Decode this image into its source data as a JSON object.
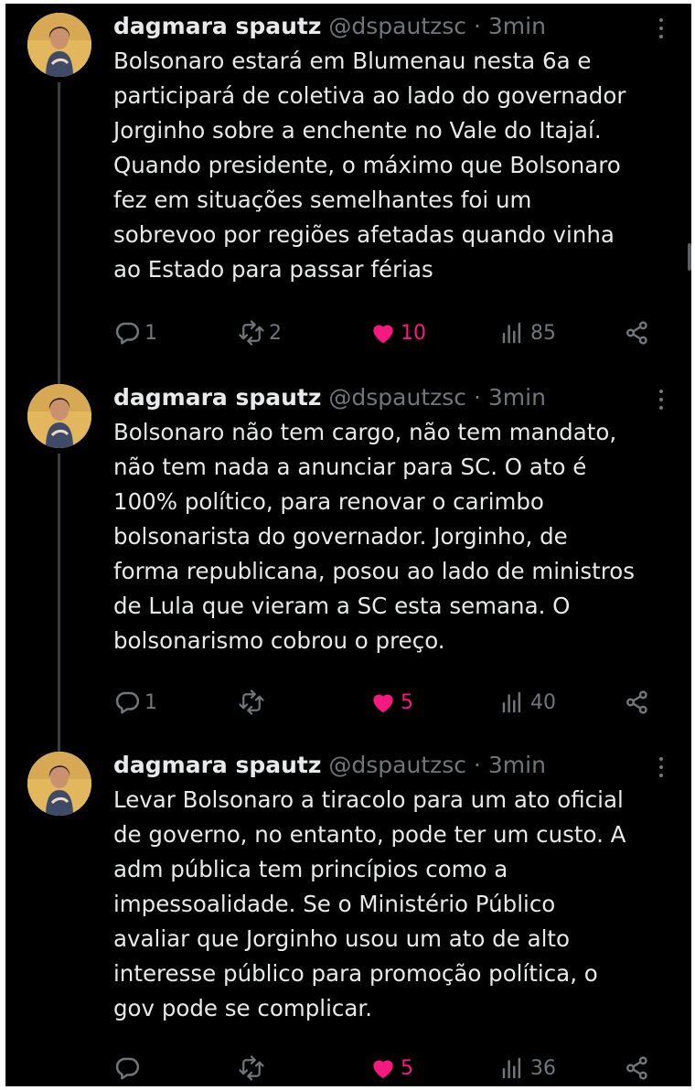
{
  "tweets": [
    {
      "name": "dagmara spautz",
      "handle": "@dspautzsc",
      "separator": "·",
      "time": "3min",
      "lines": [
        "Bolsonaro estará em Blumenau nesta 6a e",
        "participará de coletiva ao lado do governador",
        "Jorginho sobre a enchente no Vale do Itajaí.",
        "Quando presidente, o máximo que Bolsonaro",
        "fez em situações semelhantes foi um",
        "sobrevoo por regiões afetadas quando vinha",
        "ao Estado para passar férias"
      ],
      "replies": "1",
      "retweets": "2",
      "likes": "10",
      "views": "85"
    },
    {
      "name": "dagmara spautz",
      "handle": "@dspautzsc",
      "separator": "·",
      "time": "3min",
      "lines": [
        "Bolsonaro não tem cargo, não tem mandato,",
        "não tem nada a anunciar para SC. O ato é",
        "100% político, para renovar o carimbo",
        "bolsonarista do governador. Jorginho, de",
        "forma republicana, posou ao lado de ministros",
        "de Lula que vieram a SC esta semana. O",
        "bolsonarismo cobrou o preço."
      ],
      "replies": "1",
      "retweets": "",
      "likes": "5",
      "views": "40"
    },
    {
      "name": "dagmara spautz",
      "handle": "@dspautzsc",
      "separator": "·",
      "time": "3min",
      "lines": [
        "Levar Bolsonaro a tiracolo para um ato oficial",
        "de governo, no entanto, pode ter um custo. A",
        "adm pública tem princípios como a",
        "impessoalidade. Se o Ministério Público",
        "avaliar que Jorginho usou um ato de alto",
        "interesse público para promoção política, o",
        "gov pode se complicar."
      ],
      "replies": "",
      "retweets": "",
      "likes": "5",
      "views": "36"
    }
  ],
  "colors": {
    "background": "#000000",
    "text": "#e7e9ea",
    "muted": "#71767b",
    "like": "#f91880",
    "thread_line": "#3a3f44"
  },
  "icons": [
    "reply-icon",
    "retweet-icon",
    "heart-icon",
    "views-icon",
    "share-icon",
    "more-icon"
  ]
}
